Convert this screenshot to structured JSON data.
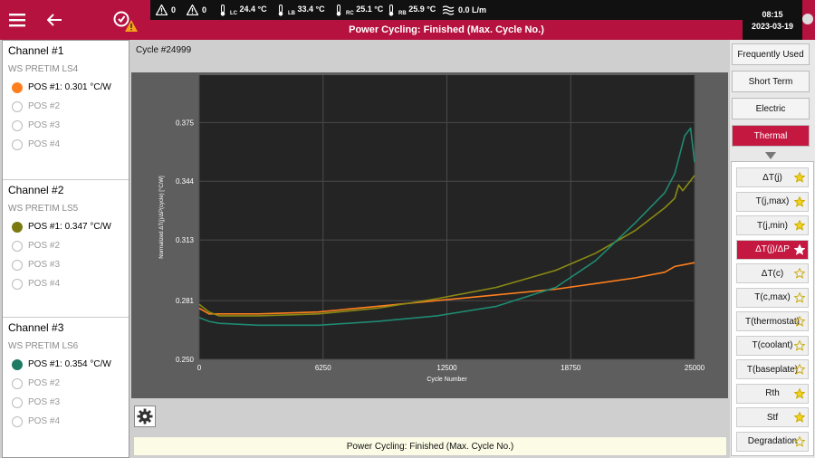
{
  "status_bar": {
    "warn1_count": "0",
    "warn2_count": "0",
    "temps": [
      {
        "sub": "LC",
        "value": "24.4 °C"
      },
      {
        "sub": "LB",
        "value": "33.4 °C"
      },
      {
        "sub": "RC",
        "value": "25.1 °C"
      },
      {
        "sub": "RB",
        "value": "25.9 °C"
      }
    ],
    "flow": "0.0 L/m",
    "title": "Power Cycling: Finished (Max. Cycle No.)",
    "time": "08:15",
    "date": "2023-03-19"
  },
  "channels": [
    {
      "title": "Channel #1",
      "device": "WS PRETIM LS4",
      "positions": [
        {
          "label": "POS #1: 0.301 °C/W",
          "active": true,
          "color": "#ff7f1e"
        },
        {
          "label": "POS #2",
          "active": false
        },
        {
          "label": "POS #3",
          "active": false
        },
        {
          "label": "POS #4",
          "active": false
        }
      ]
    },
    {
      "title": "Channel #2",
      "device": "WS PRETIM LS5",
      "positions": [
        {
          "label": "POS #1: 0.347 °C/W",
          "active": true,
          "color": "#7a7a10"
        },
        {
          "label": "POS #2",
          "active": false
        },
        {
          "label": "POS #3",
          "active": false
        },
        {
          "label": "POS #4",
          "active": false
        }
      ]
    },
    {
      "title": "Channel #3",
      "device": "WS PRETIM LS6",
      "positions": [
        {
          "label": "POS #1: 0.354 °C/W",
          "active": true,
          "color": "#1f7a64"
        },
        {
          "label": "POS #2",
          "active": false
        },
        {
          "label": "POS #3",
          "active": false
        },
        {
          "label": "POS #4",
          "active": false
        }
      ]
    }
  ],
  "cycle_label": "Cycle #24999",
  "message": "Power Cycling: Finished (Max. Cycle No.)",
  "categories": [
    {
      "label": "Frequently Used",
      "active": false
    },
    {
      "label": "Short Term",
      "active": false
    },
    {
      "label": "Electric",
      "active": false
    },
    {
      "label": "Thermal",
      "active": true
    }
  ],
  "signals": [
    {
      "label": "ΔT(j)",
      "star": "filled",
      "active": false
    },
    {
      "label": "T(j,max)",
      "star": "filled",
      "active": false
    },
    {
      "label": "T(j,min)",
      "star": "filled",
      "active": false
    },
    {
      "label": "ΔT(j)/ΔP",
      "star": "filled",
      "active": true
    },
    {
      "label": "ΔT(c)",
      "star": "outline",
      "active": false
    },
    {
      "label": "T(c,max)",
      "star": "outline",
      "active": false
    },
    {
      "label": "T(thermostat)",
      "star": "outline",
      "active": false
    },
    {
      "label": "T(coolant)",
      "star": "outline",
      "active": false
    },
    {
      "label": "T(baseplate)",
      "star": "outline",
      "active": false
    },
    {
      "label": "Rth",
      "star": "filled",
      "active": false
    },
    {
      "label": "Stf",
      "star": "filled",
      "active": false
    },
    {
      "label": "Degradation",
      "star": "outline",
      "active": false
    }
  ],
  "colors": {
    "accent": "#b5123f",
    "star": "#f2d21b",
    "plot_bg": "#242424"
  },
  "chart_data": {
    "type": "line",
    "xlabel": "Cycle Number",
    "ylabel": "Normalized ΔT(j)/ΔP(cycle) [°C/W]",
    "xlim": [
      0,
      25000
    ],
    "ylim": [
      0.25,
      0.4
    ],
    "xticks": [
      0,
      6250,
      12500,
      18750,
      25000
    ],
    "yticks": [
      0.25,
      0.281,
      0.313,
      0.344,
      0.375
    ],
    "ytick_labels": [
      "0.250",
      "0.281",
      "0.313",
      "0.344",
      "0.375"
    ],
    "grid": true,
    "series": [
      {
        "color": "#ff7f1e",
        "x": [
          0,
          500,
          1000,
          3000,
          6000,
          9000,
          12000,
          15000,
          18000,
          20000,
          22000,
          23500,
          24000,
          24500,
          25000
        ],
        "y": [
          0.277,
          0.274,
          0.274,
          0.274,
          0.275,
          0.278,
          0.281,
          0.284,
          0.287,
          0.29,
          0.293,
          0.296,
          0.299,
          0.3,
          0.301
        ]
      },
      {
        "color": "#8a8a14",
        "x": [
          0,
          500,
          1000,
          3000,
          6000,
          9000,
          12000,
          15000,
          18000,
          20000,
          22000,
          23500,
          24000,
          24200,
          24400,
          25000
        ],
        "y": [
          0.279,
          0.275,
          0.273,
          0.273,
          0.274,
          0.277,
          0.282,
          0.288,
          0.297,
          0.306,
          0.318,
          0.33,
          0.335,
          0.342,
          0.339,
          0.347
        ]
      },
      {
        "color": "#1f8a72",
        "x": [
          0,
          500,
          1000,
          3000,
          6000,
          9000,
          12000,
          15000,
          18000,
          20000,
          22000,
          23500,
          24000,
          24300,
          24500,
          24800,
          25000
        ],
        "y": [
          0.272,
          0.27,
          0.269,
          0.268,
          0.268,
          0.27,
          0.273,
          0.278,
          0.288,
          0.302,
          0.322,
          0.338,
          0.348,
          0.36,
          0.368,
          0.372,
          0.354
        ]
      }
    ]
  }
}
